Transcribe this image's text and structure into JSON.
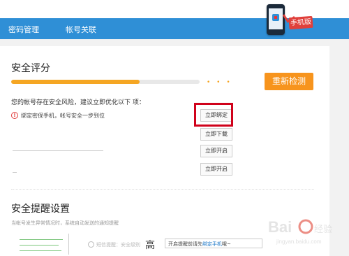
{
  "nav": {
    "items": [
      "密码管理",
      "帐号关联"
    ]
  },
  "promo": {
    "ribbon": "手机版"
  },
  "score_section": {
    "title": "安全评分",
    "progress": 0.68,
    "recheck_button": "重新检测",
    "risk_text": "您的帐号存在安全风险，建议立即优化以下  项：",
    "items": [
      {
        "text": "绑定密保手机，帐号安全一步到位",
        "action": "立即绑定"
      },
      {
        "text": "",
        "action": "立即下载"
      },
      {
        "text": "",
        "action": "立即开启"
      },
      {
        "text": "",
        "action": "立即开启"
      }
    ],
    "warn_icon": "!"
  },
  "reminder_section": {
    "title": "安全提醒设置",
    "subtitle": "当帐号发生异常情况时，系统自动发送的通知提醒",
    "option_label": "短信提醒：安全级别",
    "level": "高",
    "tip_prefix": "开启提醒前请先",
    "tip_link": "绑定手机",
    "tip_suffix": "哦~"
  },
  "watermark": {
    "text": "Bai 经验",
    "sub": "jingyan.baidu.com"
  },
  "colors": {
    "nav": "#2f8fd6",
    "accent": "#f7941d",
    "highlight": "#d0021b"
  }
}
